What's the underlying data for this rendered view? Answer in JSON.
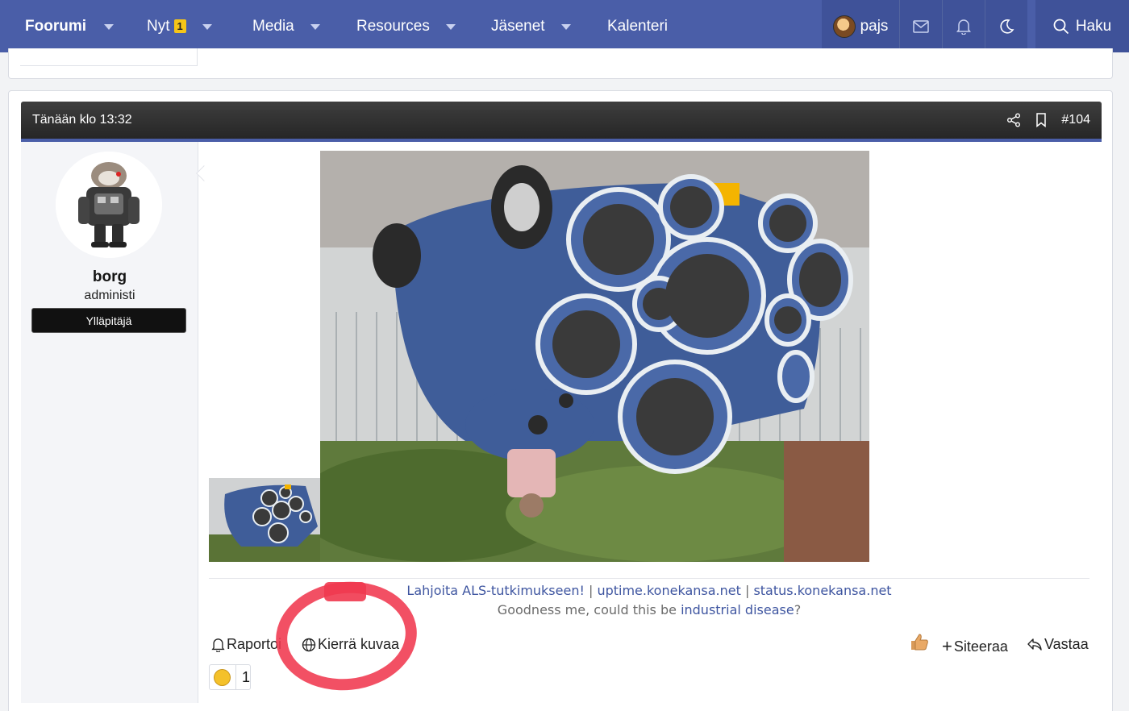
{
  "nav": {
    "items": [
      {
        "label": "Foorumi",
        "has_dropdown": true
      },
      {
        "label": "Nyt",
        "badge": "1",
        "has_dropdown": true
      },
      {
        "label": "Media",
        "has_dropdown": true
      },
      {
        "label": "Resources",
        "has_dropdown": true
      },
      {
        "label": "Jäsenet",
        "has_dropdown": true
      },
      {
        "label": "Kalenteri",
        "has_dropdown": false
      }
    ],
    "user": "pajs",
    "search_label": "Haku",
    "icons": [
      "envelope-icon",
      "bell-icon",
      "moon-icon",
      "search-icon"
    ]
  },
  "post": {
    "date": "Tänään klo 13:32",
    "number": "#104",
    "header_icons": [
      "share-icon",
      "bookmark-icon"
    ],
    "author": {
      "name": "borg",
      "title": "administi",
      "role_banner": "Ylläpitäjä"
    },
    "image_description_icon": "photo-upside-down-car-with-speakers",
    "signature": {
      "link1": "Lahjoita ALS-tutkimukseen!",
      "sep1": " | ",
      "link2": "uptime.konekansa.net",
      "sep2": " | ",
      "link3": "status.konekansa.net",
      "line2_pre": "Goodness me, could this be ",
      "line2_link": "industrial disease",
      "line2_post": "?"
    },
    "actions": {
      "report": "Raportoi",
      "rotate": "Kierrä kuvaa",
      "quote": "Siteeraa",
      "reply": "Vastaa"
    },
    "reaction": {
      "icon": "grin-emoji-icon",
      "count": "1"
    },
    "colors": {
      "nav": "#4a5ea8",
      "accent_circle": "#f0384f",
      "link": "#3e55a0"
    }
  }
}
